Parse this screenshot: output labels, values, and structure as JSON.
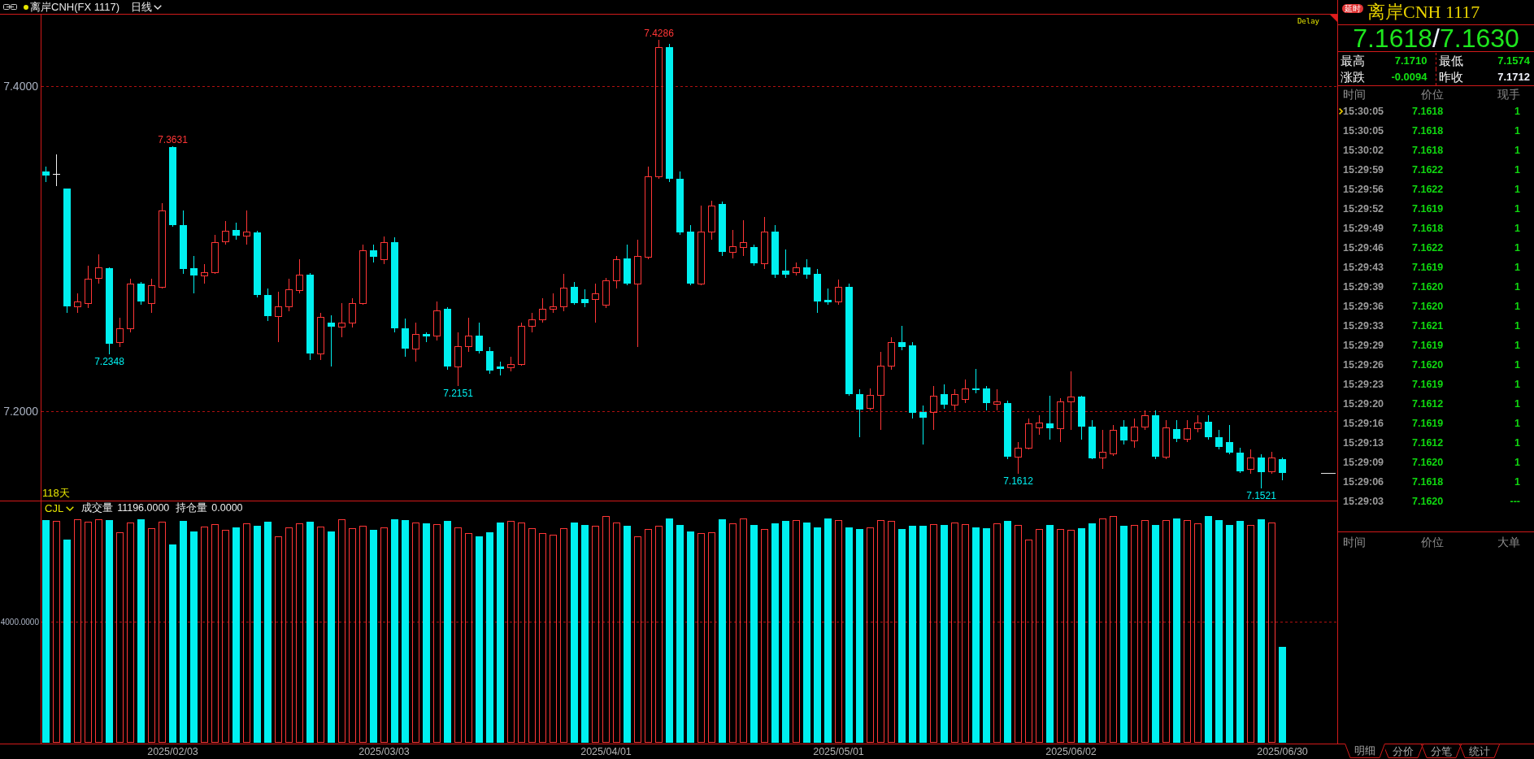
{
  "toolbar": {
    "symbol": "离岸CNH(FX 1117)",
    "period": "日线"
  },
  "price_chart": {
    "axis_labels": [
      "7.4000",
      "7.2000"
    ],
    "price_labels": [
      "7.2348",
      "7.3631",
      "7.2151",
      "7.4286",
      "7.1612",
      "7.1521"
    ],
    "delay_label": "Delay",
    "day_count": "118天"
  },
  "volume_chart": {
    "indicator": "CJL",
    "fields": [
      {
        "label": "成交量",
        "value": "11196.0000"
      },
      {
        "label": "持仓量",
        "value": "0.0000"
      }
    ],
    "axis_label": "4000.0000"
  },
  "date_axis": {
    "labels": [
      "2025/02/03",
      "2025/03/03",
      "2025/04/01",
      "2025/05/01",
      "2025/06/02",
      "2025/06/30"
    ]
  },
  "quote": {
    "badge": "延时",
    "title": "离岸CNH 1117",
    "bid": "7.1618",
    "separator": "/",
    "ask": "7.1630",
    "stats": [
      {
        "label": "最高",
        "value": "7.1710",
        "color": "#12e012"
      },
      {
        "label": "最低",
        "value": "7.1574",
        "color": "#12e012"
      },
      {
        "label": "涨跌",
        "value": "-0.0094",
        "color": "#12e012"
      },
      {
        "label": "昨收",
        "value": "7.1712",
        "color": "#f2f4ff"
      }
    ]
  },
  "ticks": {
    "columns": [
      "时间",
      "价位",
      "现手"
    ],
    "rows": [
      {
        "time": "15:30:05",
        "price": "7.1618",
        "volume": "1",
        "selected": true
      },
      {
        "time": "15:30:05",
        "price": "7.1618",
        "volume": "1",
        "selected": false
      },
      {
        "time": "15:30:02",
        "price": "7.1618",
        "volume": "1",
        "selected": false
      },
      {
        "time": "15:29:59",
        "price": "7.1622",
        "volume": "1",
        "selected": false
      },
      {
        "time": "15:29:56",
        "price": "7.1622",
        "volume": "1",
        "selected": false
      },
      {
        "time": "15:29:52",
        "price": "7.1619",
        "volume": "1",
        "selected": false
      },
      {
        "time": "15:29:49",
        "price": "7.1618",
        "volume": "1",
        "selected": false
      },
      {
        "time": "15:29:46",
        "price": "7.1622",
        "volume": "1",
        "selected": false
      },
      {
        "time": "15:29:43",
        "price": "7.1619",
        "volume": "1",
        "selected": false
      },
      {
        "time": "15:29:39",
        "price": "7.1620",
        "volume": "1",
        "selected": false
      },
      {
        "time": "15:29:36",
        "price": "7.1620",
        "volume": "1",
        "selected": false
      },
      {
        "time": "15:29:33",
        "price": "7.1621",
        "volume": "1",
        "selected": false
      },
      {
        "time": "15:29:29",
        "price": "7.1619",
        "volume": "1",
        "selected": false
      },
      {
        "time": "15:29:26",
        "price": "7.1620",
        "volume": "1",
        "selected": false
      },
      {
        "time": "15:29:23",
        "price": "7.1619",
        "volume": "1",
        "selected": false
      },
      {
        "time": "15:29:20",
        "price": "7.1612",
        "volume": "1",
        "selected": false
      },
      {
        "time": "15:29:16",
        "price": "7.1619",
        "volume": "1",
        "selected": false
      },
      {
        "time": "15:29:13",
        "price": "7.1612",
        "volume": "1",
        "selected": false
      },
      {
        "time": "15:29:09",
        "price": "7.1620",
        "volume": "1",
        "selected": false
      },
      {
        "time": "15:29:06",
        "price": "7.1618",
        "volume": "1",
        "selected": false
      },
      {
        "time": "15:29:03",
        "price": "7.1620",
        "volume": "---",
        "selected": false
      }
    ]
  },
  "big_orders": {
    "columns": [
      "时间",
      "价位",
      "大单"
    ]
  },
  "tabs": [
    {
      "label": "明细",
      "selected": true
    },
    {
      "label": "分价",
      "selected": false
    },
    {
      "label": "分笔",
      "selected": false
    },
    {
      "label": "统计",
      "selected": false
    }
  ]
}
